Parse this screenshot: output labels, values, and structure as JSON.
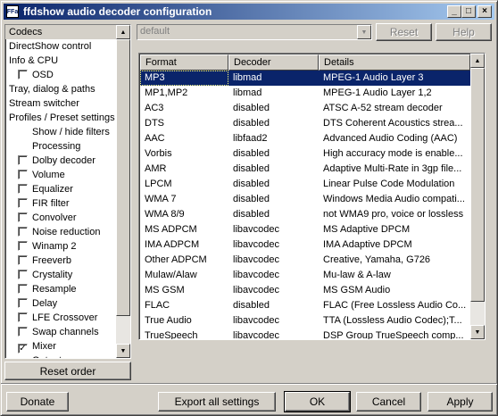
{
  "window": {
    "title": "ffdshow audio decoder configuration",
    "icon_text": "FFa",
    "controls": {
      "minimize": "_",
      "maximize": "□",
      "close": "×"
    }
  },
  "sidebar": {
    "items": [
      {
        "label": "Codecs",
        "checkbox": false,
        "level": 0,
        "selected": true
      },
      {
        "label": "DirectShow control",
        "checkbox": false,
        "level": 0
      },
      {
        "label": "Info & CPU",
        "checkbox": false,
        "level": 0
      },
      {
        "label": "OSD",
        "checkbox": true,
        "checked": false,
        "level": 1
      },
      {
        "label": "Tray, dialog & paths",
        "checkbox": false,
        "level": 0
      },
      {
        "label": "Stream switcher",
        "checkbox": false,
        "level": 0
      },
      {
        "label": "Profiles / Preset settings",
        "checkbox": false,
        "level": 0
      },
      {
        "label": "Show / hide filters",
        "checkbox": false,
        "level": 2
      },
      {
        "label": "Processing",
        "checkbox": false,
        "level": 2
      },
      {
        "label": "Dolby decoder",
        "checkbox": true,
        "checked": false,
        "level": 1
      },
      {
        "label": "Volume",
        "checkbox": true,
        "checked": false,
        "level": 1
      },
      {
        "label": "Equalizer",
        "checkbox": true,
        "checked": false,
        "level": 1
      },
      {
        "label": "FIR filter",
        "checkbox": true,
        "checked": false,
        "level": 1
      },
      {
        "label": "Convolver",
        "checkbox": true,
        "checked": false,
        "level": 1
      },
      {
        "label": "Noise reduction",
        "checkbox": true,
        "checked": false,
        "level": 1
      },
      {
        "label": "Winamp 2",
        "checkbox": true,
        "checked": false,
        "level": 1
      },
      {
        "label": "Freeverb",
        "checkbox": true,
        "checked": false,
        "level": 1
      },
      {
        "label": "Crystality",
        "checkbox": true,
        "checked": false,
        "level": 1
      },
      {
        "label": "Resample",
        "checkbox": true,
        "checked": false,
        "level": 1
      },
      {
        "label": "Delay",
        "checkbox": true,
        "checked": false,
        "level": 1
      },
      {
        "label": "LFE Crossover",
        "checkbox": true,
        "checked": false,
        "level": 1
      },
      {
        "label": "Swap channels",
        "checkbox": true,
        "checked": false,
        "level": 1
      },
      {
        "label": "Mixer",
        "checkbox": true,
        "checked": true,
        "level": 1
      },
      {
        "label": "Output",
        "checkbox": false,
        "level": 2
      }
    ],
    "reset_order_label": "Reset order"
  },
  "preset": {
    "selected": "default",
    "reset_label": "Reset",
    "help_label": "Help"
  },
  "codec_table": {
    "columns": [
      "Format",
      "Decoder",
      "Details"
    ],
    "rows": [
      [
        "MP3",
        "libmad",
        "MPEG-1 Audio Layer 3"
      ],
      [
        "MP1,MP2",
        "libmad",
        "MPEG-1 Audio Layer 1,2"
      ],
      [
        "AC3",
        "disabled",
        "ATSC A-52 stream decoder"
      ],
      [
        "DTS",
        "disabled",
        "DTS Coherent Acoustics strea..."
      ],
      [
        "AAC",
        "libfaad2",
        "Advanced Audio Coding (AAC)"
      ],
      [
        "Vorbis",
        "disabled",
        "High accuracy mode is enable..."
      ],
      [
        "AMR",
        "disabled",
        "Adaptive Multi-Rate in 3gp file..."
      ],
      [
        "LPCM",
        "disabled",
        "Linear Pulse Code Modulation"
      ],
      [
        "WMA 7",
        "disabled",
        "Windows Media Audio compati..."
      ],
      [
        "WMA 8/9",
        "disabled",
        "not WMA9 pro, voice or lossless"
      ],
      [
        "MS ADPCM",
        "libavcodec",
        "MS Adaptive DPCM"
      ],
      [
        "IMA ADPCM",
        "libavcodec",
        "IMA Adaptive DPCM"
      ],
      [
        "Other ADPCM",
        "libavcodec",
        "Creative, Yamaha, G726"
      ],
      [
        "Mulaw/Alaw",
        "libavcodec",
        "Mu-law & A-law"
      ],
      [
        "MS GSM",
        "libavcodec",
        "MS GSM Audio"
      ],
      [
        "FLAC",
        "disabled",
        "FLAC (Free Lossless Audio Co..."
      ],
      [
        "True Audio",
        "libavcodec",
        "TTA (Lossless Audio Codec);T..."
      ],
      [
        "TrueSpeech",
        "libavcodec",
        "DSP Group TrueSpeech comp..."
      ]
    ],
    "selected_row": 0
  },
  "footer": {
    "donate_label": "Donate",
    "export_label": "Export all settings",
    "ok_label": "OK",
    "cancel_label": "Cancel",
    "apply_label": "Apply"
  },
  "colors": {
    "titlebar_start": "#0a246a",
    "titlebar_end": "#a6caf0",
    "selection": "#0a246a",
    "face": "#d4d0c8"
  }
}
